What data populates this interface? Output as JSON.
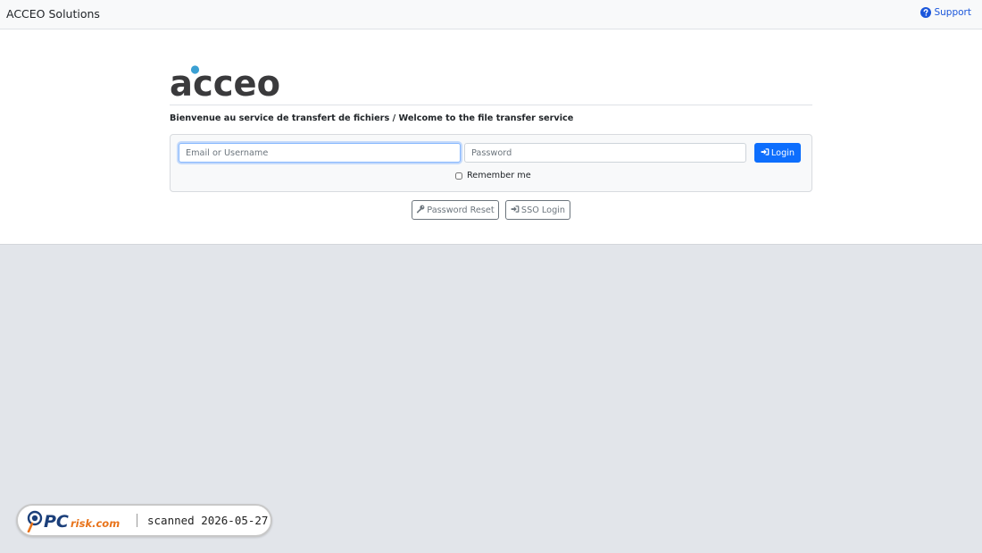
{
  "header": {
    "brand": "ACCEO Solutions",
    "support_label": "Support",
    "support_icon": "question-circle-icon"
  },
  "logo": {
    "text": "acceo",
    "dot_color": "#3aa0d3",
    "text_color": "#3a3a3c"
  },
  "welcome": "Bienvenue au service de transfert de fichiers / Welcome to the file transfer service",
  "login_form": {
    "email_placeholder": "Email or Username",
    "email_value": "",
    "password_placeholder": "Password",
    "password_value": "",
    "login_label": "Login",
    "login_icon": "sign-in-icon",
    "remember_label": "Remember me",
    "remember_checked": false
  },
  "secondary_actions": {
    "password_reset_label": "Password Reset",
    "password_reset_icon": "key-icon",
    "sso_login_label": "SSO Login",
    "sso_login_icon": "sign-in-icon"
  },
  "watermark": {
    "logo_text": "PCrisk.com",
    "scan_text": "scanned 2026-05-27"
  },
  "colors": {
    "primary": "#0d6efd",
    "link": "#1a56db",
    "page_background": "#e2e5ea",
    "secondary_border": "#6c757d"
  }
}
